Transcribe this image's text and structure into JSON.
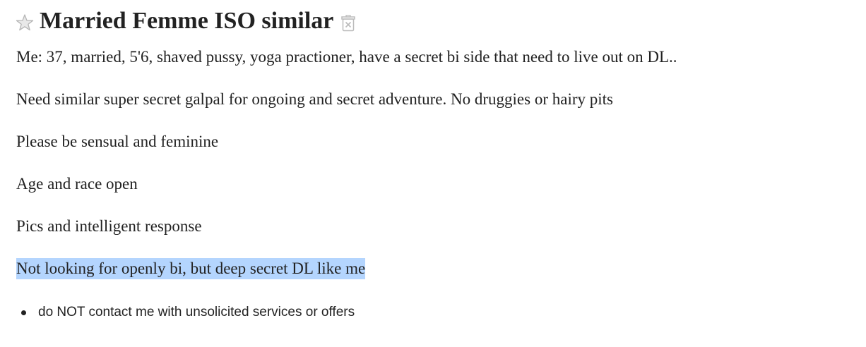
{
  "posting": {
    "title": "Married Femme ISO similar",
    "favorite_icon": "star-icon",
    "hide_icon": "trash-icon",
    "body": [
      "Me: 37, married, 5'6, shaved pussy, yoga practioner, have a secret bi side that need to live out on DL..",
      "Need similar super secret galpal for ongoing and secret adventure. No druggies or hairy pits",
      "Please be sensual and feminine",
      "Age and race open",
      "Pics and intelligent response",
      "Not looking for openly bi, but deep secret DL like me"
    ],
    "notices": [
      "do NOT contact me with unsolicited services or offers"
    ]
  },
  "colors": {
    "text": "#222222",
    "selection_highlight": "#b4d5fe",
    "icon_gray": "#bbbbbb"
  }
}
